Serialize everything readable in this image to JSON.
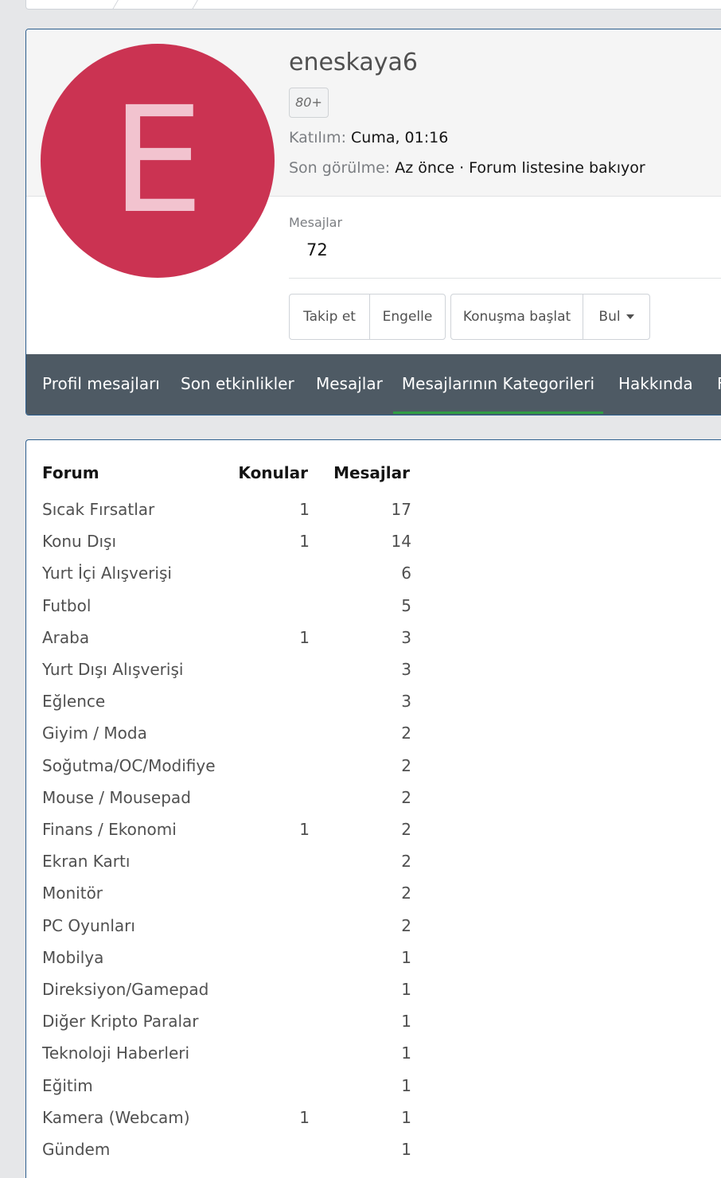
{
  "profile": {
    "avatar_letter": "E",
    "username": "eneskaya6",
    "badge": "80+",
    "joined_label": "Katılım:",
    "joined_value": "Cuma, 01:16",
    "last_seen_label": "Son görülme:",
    "last_seen_value": "Az önce · Forum listesine bakıyor",
    "messages_label": "Mesajlar",
    "messages_value": "72"
  },
  "actions": {
    "follow": "Takip et",
    "ignore": "Engelle",
    "start_conversation": "Konuşma başlat",
    "find": "Bul"
  },
  "tabs": [
    {
      "label": "Profil mesajları",
      "active": false
    },
    {
      "label": "Son etkinlikler",
      "active": false
    },
    {
      "label": "Mesajlar",
      "active": false
    },
    {
      "label": "Mesajlarının Kategorileri",
      "active": true
    },
    {
      "label": "Hakkında",
      "active": false
    },
    {
      "label": "F",
      "active": false
    }
  ],
  "table": {
    "columns": [
      "Forum",
      "Konular",
      "Mesajlar"
    ],
    "rows": [
      {
        "forum": "Sıcak Fırsatlar",
        "topics": "1",
        "messages": "17"
      },
      {
        "forum": "Konu Dışı",
        "topics": "1",
        "messages": "14"
      },
      {
        "forum": "Yurt İçi Alışverişi",
        "topics": "",
        "messages": "6"
      },
      {
        "forum": "Futbol",
        "topics": "",
        "messages": "5"
      },
      {
        "forum": "Araba",
        "topics": "1",
        "messages": "3"
      },
      {
        "forum": "Yurt Dışı Alışverişi",
        "topics": "",
        "messages": "3"
      },
      {
        "forum": "Eğlence",
        "topics": "",
        "messages": "3"
      },
      {
        "forum": "Giyim / Moda",
        "topics": "",
        "messages": "2"
      },
      {
        "forum": "Soğutma/OC/Modifiye",
        "topics": "",
        "messages": "2"
      },
      {
        "forum": "Mouse / Mousepad",
        "topics": "",
        "messages": "2"
      },
      {
        "forum": "Finans / Ekonomi",
        "topics": "1",
        "messages": "2"
      },
      {
        "forum": "Ekran Kartı",
        "topics": "",
        "messages": "2"
      },
      {
        "forum": "Monitör",
        "topics": "",
        "messages": "2"
      },
      {
        "forum": "PC Oyunları",
        "topics": "",
        "messages": "2"
      },
      {
        "forum": "Mobilya",
        "topics": "",
        "messages": "1"
      },
      {
        "forum": "Direksiyon/Gamepad",
        "topics": "",
        "messages": "1"
      },
      {
        "forum": "Diğer Kripto Paralar",
        "topics": "",
        "messages": "1"
      },
      {
        "forum": "Teknoloji Haberleri",
        "topics": "",
        "messages": "1"
      },
      {
        "forum": "Eğitim",
        "topics": "",
        "messages": "1"
      },
      {
        "forum": "Kamera (Webcam)",
        "topics": "1",
        "messages": "1"
      },
      {
        "forum": "Gündem",
        "topics": "",
        "messages": "1"
      }
    ]
  },
  "colors": {
    "avatar_bg": "#cb3352",
    "avatar_letter": "#f2c3cf",
    "tabbar_bg": "#4e5a64",
    "tab_active_underline": "#2f9e44",
    "card_border": "#2d5f8e"
  }
}
